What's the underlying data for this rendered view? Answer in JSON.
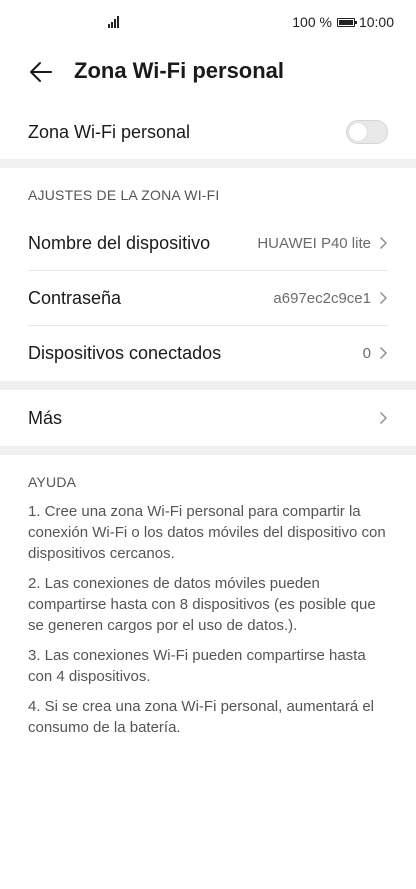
{
  "status_bar": {
    "battery_text": "100 %",
    "time": "10:00"
  },
  "header": {
    "title": "Zona Wi-Fi personal"
  },
  "hotspot_toggle": {
    "label": "Zona Wi-Fi personal",
    "enabled": false
  },
  "settings": {
    "section_title": "AJUSTES DE LA ZONA WI-FI",
    "device_name": {
      "label": "Nombre del dispositivo",
      "value": "HUAWEI P40 lite"
    },
    "password": {
      "label": "Contraseña",
      "value": "a697ec2c9ce1"
    },
    "connected_devices": {
      "label": "Dispositivos conectados",
      "value": "0"
    }
  },
  "more": {
    "label": "Más"
  },
  "help": {
    "title": "AYUDA",
    "items": [
      "1. Cree una zona Wi-Fi personal para compartir la conexión Wi-Fi o los datos móviles del dispositivo con dispositivos cercanos.",
      "2. Las conexiones de datos móviles pueden compartirse hasta con 8 dispositivos (es posible que se generen cargos por el uso de datos.).",
      "3. Las conexiones Wi-Fi pueden compartirse hasta con 4 dispositivos.",
      "4. Si se crea una zona Wi-Fi personal, aumentará el consumo de la batería."
    ]
  }
}
